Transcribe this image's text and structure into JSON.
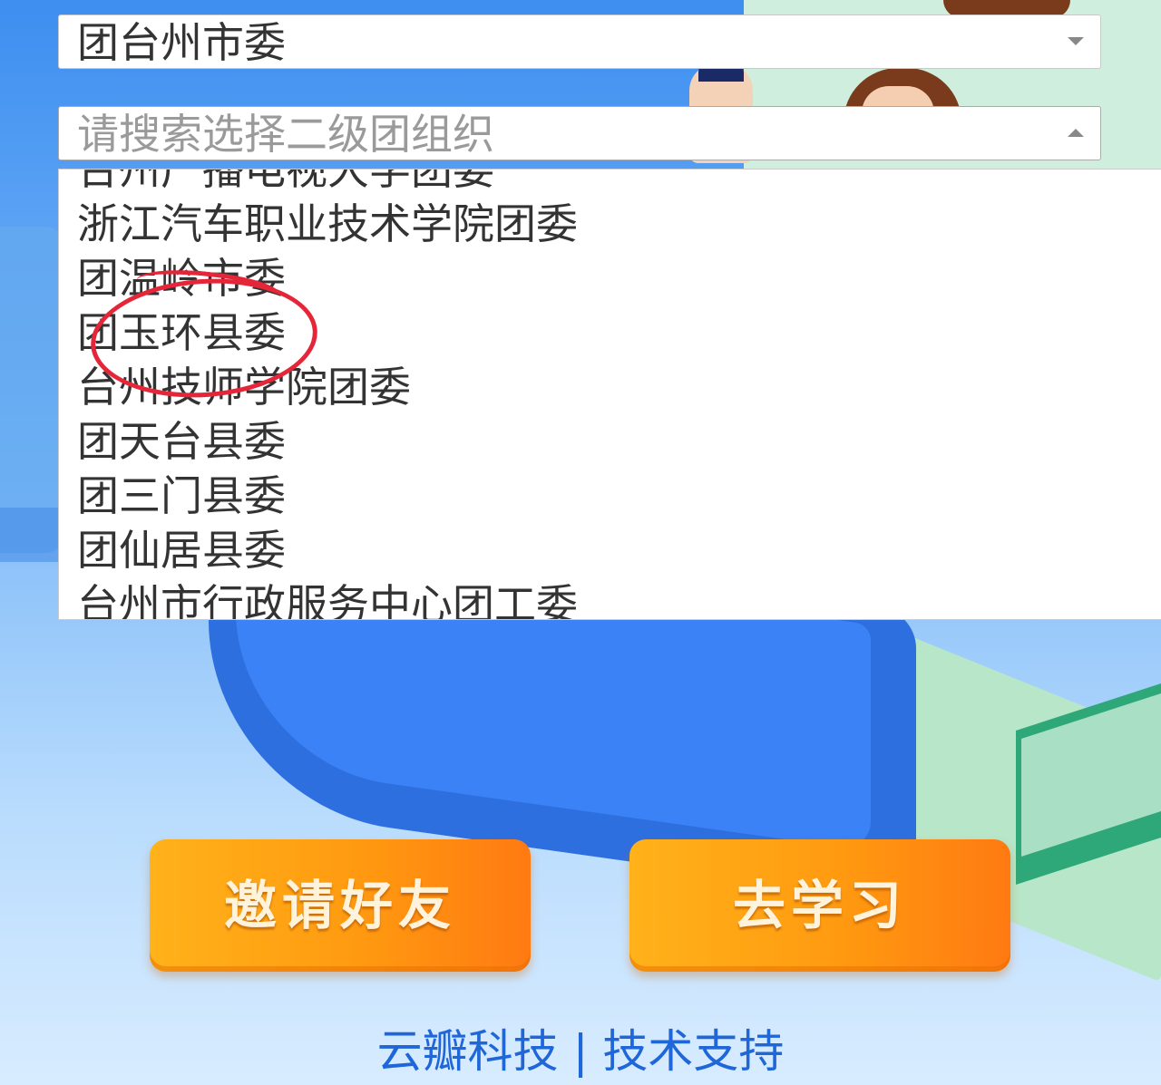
{
  "select_primary": {
    "value": "团台州市委"
  },
  "select_secondary": {
    "placeholder": "请搜索选择二级团组织"
  },
  "dropdown": {
    "options": [
      "台州广播电视大学团委",
      "浙江汽车职业技术学院团委",
      "团温岭市委",
      "团玉环县委",
      "台州技师学院团委",
      "团天台县委",
      "团三门县委",
      "团仙居县委",
      "台州市行政服务中心团工委"
    ],
    "annotated_option": "团玉环县委",
    "annotation_color": "#e52638"
  },
  "buttons": {
    "invite_label": "邀请好友",
    "study_label": "去学习"
  },
  "footer": {
    "company": "云瓣科技",
    "separator": "|",
    "support": "技术支持"
  },
  "colors": {
    "button_orange": "#ff9a10",
    "footer_blue": "#1f66d8"
  }
}
